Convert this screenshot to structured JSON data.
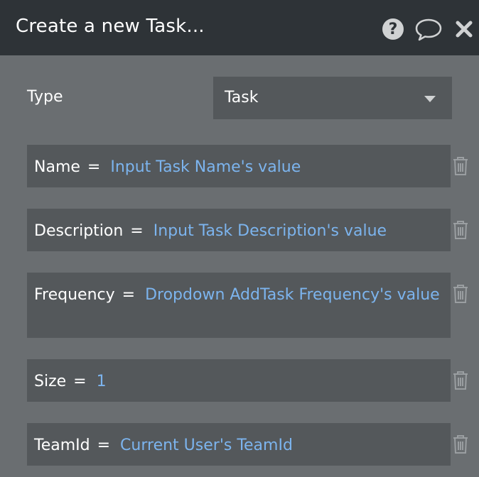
{
  "header": {
    "title": "Create a new Task...",
    "icons": [
      "help-icon",
      "comment-icon",
      "close-icon"
    ]
  },
  "type_row": {
    "label": "Type",
    "selected": "Task"
  },
  "fields": [
    {
      "key": "Name",
      "eq": "=",
      "value": "Input Task Name's value"
    },
    {
      "key": "Description",
      "eq": "=",
      "value": "Input Task Description's value"
    },
    {
      "key": "Frequency",
      "eq": "=",
      "value": "Dropdown AddTask Frequency's value"
    },
    {
      "key": "Size",
      "eq": "=",
      "value": "1"
    },
    {
      "key": "TeamId",
      "eq": "=",
      "value": "Current User's TeamId"
    }
  ],
  "colors": {
    "header_bg": "#2e3337",
    "panel_bg": "#6a6e71",
    "field_bg": "#54585b",
    "value_text": "#7cb4ee",
    "icon": "#d0d2d3"
  }
}
